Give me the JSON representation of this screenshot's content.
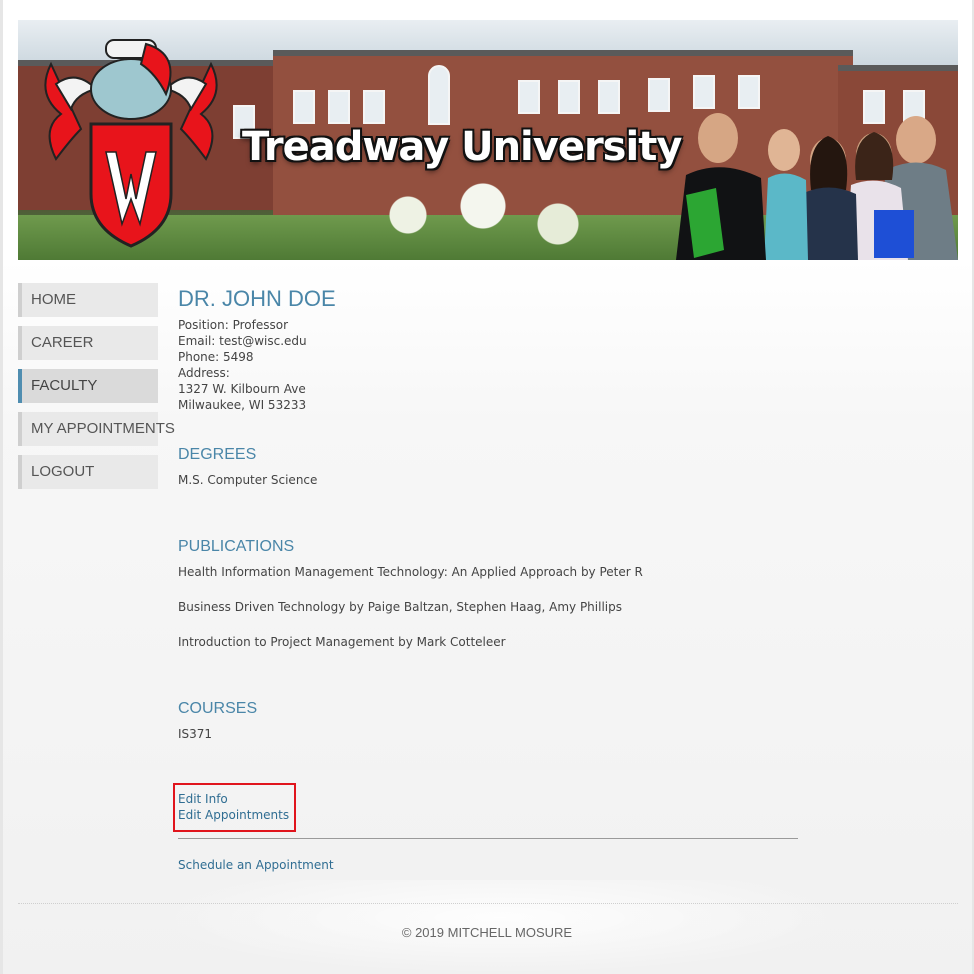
{
  "banner": {
    "title": "Treadway University"
  },
  "sidebar": {
    "items": [
      {
        "label": "HOME"
      },
      {
        "label": "CAREER"
      },
      {
        "label": "FACULTY"
      },
      {
        "label": "MY APPOINTMENTS"
      },
      {
        "label": "LOGOUT"
      }
    ],
    "active_index": 2
  },
  "profile": {
    "name": "DR. JOHN DOE",
    "position": "Position: Professor",
    "email": "Email: test@wisc.edu",
    "phone": "Phone: 5498",
    "address_label": "Address:",
    "address_line1": "1327 W. Kilbourn Ave",
    "address_line2": "Milwaukee, WI 53233"
  },
  "degrees": {
    "title": "DEGREES",
    "items": [
      "M.S. Computer Science"
    ]
  },
  "publications": {
    "title": "PUBLICATIONS",
    "items": [
      "Health Information Management Technology: An Applied Approach by Peter R",
      "Business Driven Technology by Paige Baltzan, Stephen Haag, Amy Phillips",
      "Introduction to Project Management by Mark Cotteleer"
    ]
  },
  "courses": {
    "title": "COURSES",
    "items": [
      "IS371"
    ]
  },
  "actions": {
    "edit_info": "Edit Info",
    "edit_appointments": "Edit Appointments",
    "schedule": "Schedule an Appointment"
  },
  "footer": {
    "copyright": "© 2019 MITCHELL MOSURE"
  },
  "colors": {
    "accent": "#4a86a8",
    "link": "#2f6d92",
    "highlight_box": "#e0141c",
    "crest_red": "#e8141b"
  }
}
